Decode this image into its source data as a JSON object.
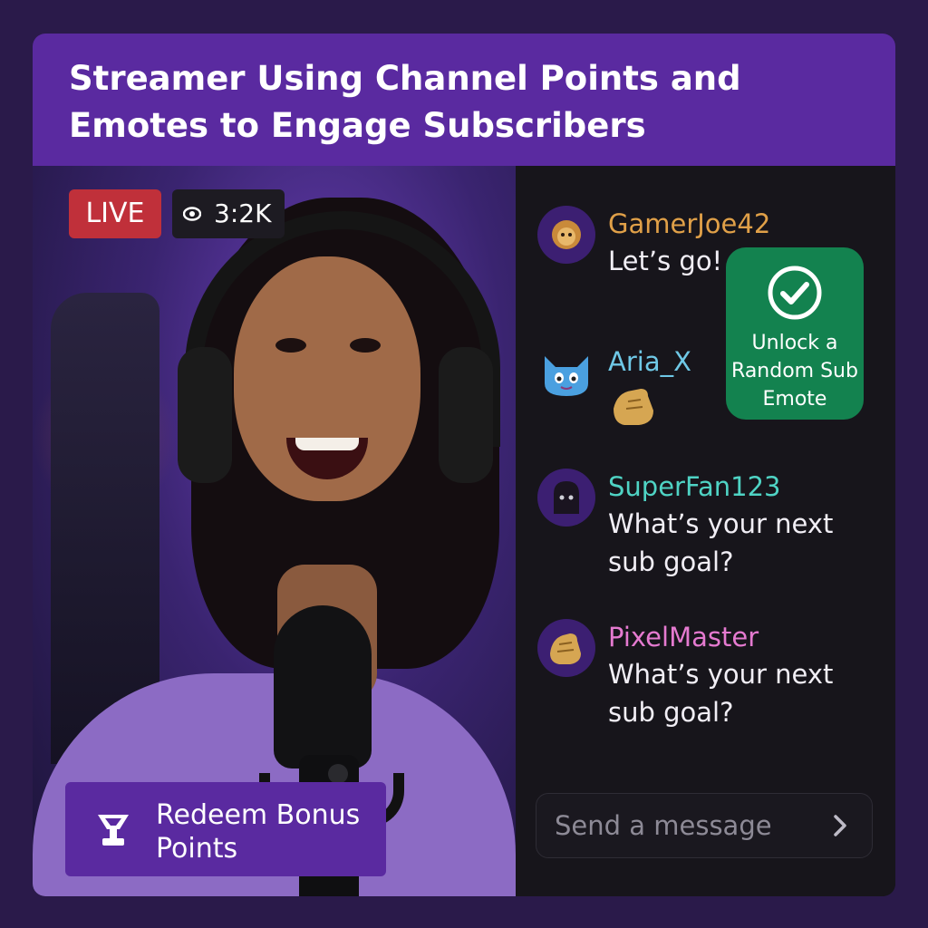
{
  "title": "Streamer Using Channel Points and Emotes to Engage Subscribers",
  "stream": {
    "live_label": "LIVE",
    "viewer_count": "3:2K",
    "redeem_label": "Redeem Bonus Points"
  },
  "chat": {
    "messages": [
      {
        "user": "GamerJoe42",
        "text": "Let’s go!",
        "user_color": "#e0a048",
        "avatar_icon": "lion-emote-icon"
      },
      {
        "user": "Aria_X",
        "text": "",
        "user_color": "#6fc8e6",
        "avatar_icon": "cat-emote-icon",
        "emote": "clap-hand-emote-icon"
      },
      {
        "user": "SuperFan123",
        "text": "What’s your next sub goal?",
        "user_color": "#4fd3c4",
        "avatar_icon": "hooded-figure-icon"
      },
      {
        "user": "PixelMaster",
        "text": "What’s your next sub goal?",
        "user_color": "#e57ad0",
        "avatar_icon": "clap-hand-icon"
      }
    ],
    "unlock_label": "Unlock a Random Sub Emote",
    "input_placeholder": "Send a message"
  },
  "colors": {
    "accent_purple": "#5a2aa0",
    "live_red": "#c0303a",
    "unlock_green": "#13824f"
  }
}
